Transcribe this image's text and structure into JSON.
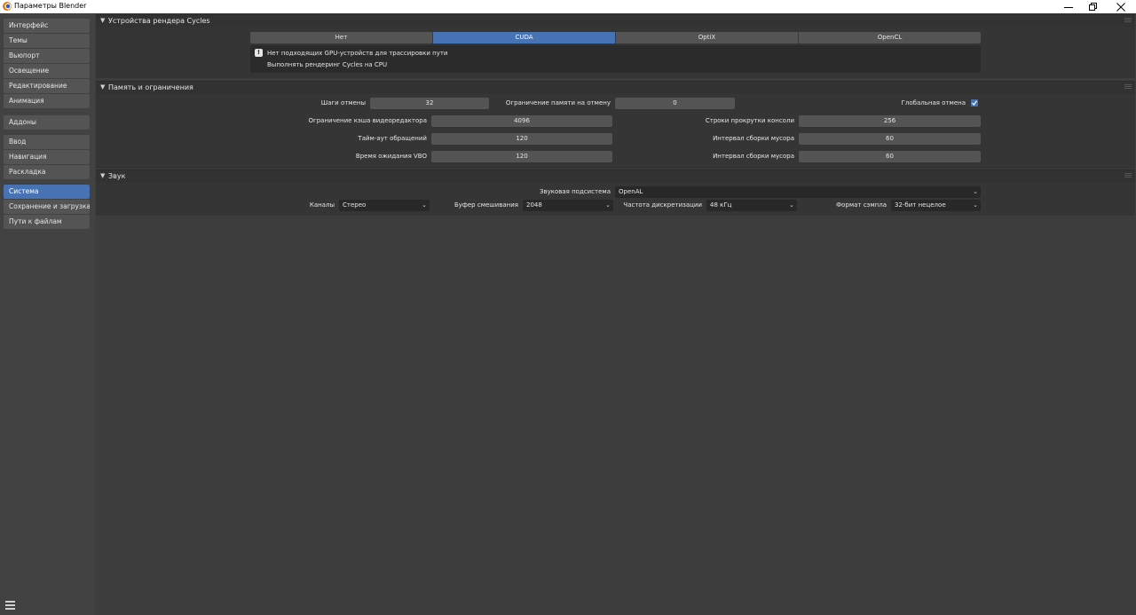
{
  "window": {
    "title": "Параметры Blender"
  },
  "sidebar": {
    "groups": [
      {
        "items": [
          "Интерфейс",
          "Темы",
          "Вьюпорт",
          "Освещение",
          "Редактирование",
          "Анимация"
        ]
      },
      {
        "items": [
          "Аддоны"
        ]
      },
      {
        "items": [
          "Ввод",
          "Навигация",
          "Раскладка"
        ]
      },
      {
        "items": [
          "Система",
          "Сохранение и загрузка",
          "Пути к файлам"
        ]
      }
    ],
    "active_item": "Система"
  },
  "cycles": {
    "header": "Устройства рендера Cycles",
    "tabs": [
      "Нет",
      "CUDA",
      "OptiX",
      "OpenCL"
    ],
    "active_tab": "CUDA",
    "info_line1": "Нет подходящих GPU-устройств для трассировки пути",
    "info_line2": "Выполнять рендеринг Cycles на CPU"
  },
  "memory": {
    "header": "Память и ограничения",
    "undo_steps_label": "Шаги отмены",
    "undo_steps_value": "32",
    "undo_memory_label": "Ограничение памяти на отмену",
    "undo_memory_value": "0",
    "global_undo_label": "Глобальная отмена",
    "global_undo_checked": true,
    "sequencer_cache_label": "Ограничение кэша видеоредактора",
    "sequencer_cache_value": "4096",
    "console_scrollback_label": "Строки прокрутки консоли",
    "console_scrollback_value": "256",
    "texture_timeout_label": "Тайм-аут обращений",
    "texture_timeout_value": "120",
    "texture_gc_label": "Интервал сборки мусора",
    "texture_gc_value": "60",
    "vbo_timeout_label": "Время ожидания VBO",
    "vbo_timeout_value": "120",
    "vbo_gc_label": "Интервал сборки мусора",
    "vbo_gc_value": "60"
  },
  "sound": {
    "header": "Звук",
    "device_label": "Звуковая подсистема",
    "device_value": "OpenAL",
    "channels_label": "Каналы",
    "channels_value": "Стерео",
    "mixing_buffer_label": "Буфер смешивания",
    "mixing_buffer_value": "2048",
    "sample_rate_label": "Частота дискретизации",
    "sample_rate_value": "48 кГц",
    "sample_format_label": "Формат сэмпла",
    "sample_format_value": "32-бит нецелое"
  },
  "colors": {
    "accent": "#4772b3",
    "background": "#3d3d3d",
    "field": "#545454"
  }
}
